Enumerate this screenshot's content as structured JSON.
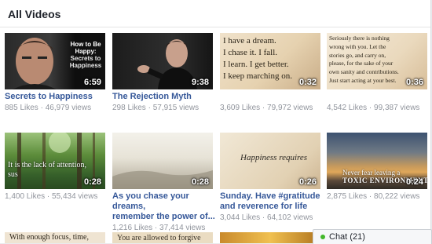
{
  "header": {
    "title": "All Videos"
  },
  "videos": [
    {
      "title": "Secrets to Happiness",
      "likes": "885 Likes",
      "views": "46,979 views",
      "duration": "6:59",
      "overlay": [
        "How to Be",
        "Happy:",
        "Secrets to",
        "Happiness"
      ]
    },
    {
      "title": "The Rejection Myth",
      "likes": "298 Likes",
      "views": "57,915 views",
      "duration": "9:38"
    },
    {
      "title": "",
      "likes": "3,609 Likes",
      "views": "79,972 views",
      "duration": "0:32",
      "overlay": [
        "I have a dream.",
        "I chase it. I fall.",
        "I learn. I get better.",
        "I keep marching on."
      ]
    },
    {
      "title": "",
      "likes": "4,542 Likes",
      "views": "99,387 views",
      "duration": "0:36",
      "overlay": [
        "Seriously there is nothing",
        "wrong with you. Let the",
        "stories go, and carry on,",
        "please, for the sake of your",
        "own sanity and contributions.",
        "Just start acting at your best."
      ]
    },
    {
      "title": "",
      "likes": "1,400 Likes",
      "views": "55,434 views",
      "duration": "0:28",
      "overlay": [
        "It is the lack of attention,",
        "sus"
      ]
    },
    {
      "title1": "As you chase your dreams,",
      "title2": "remember the power of...",
      "likes": "1,216 Likes",
      "views": "37,414 views",
      "duration": "0:28"
    },
    {
      "title1": "Sunday. Have #gratitude",
      "title2": "and reverence for life",
      "likes": "3,044 Likes",
      "views": "64,102 views",
      "duration": "0:26",
      "overlay": [
        "Happiness requires"
      ]
    },
    {
      "title": "",
      "likes": "2,875 Likes",
      "views": "80,222 views",
      "duration": "0:24",
      "overlay": [
        "Never fear leaving a",
        "TOXIC ENVIRONMENT"
      ]
    },
    {
      "overlay": [
        "With enough focus, time,"
      ]
    },
    {
      "overlay": [
        "You are allowed to forgive"
      ]
    }
  ],
  "sep": " · ",
  "chat": {
    "label": "Chat (21)",
    "status_color": "#42b72a"
  }
}
